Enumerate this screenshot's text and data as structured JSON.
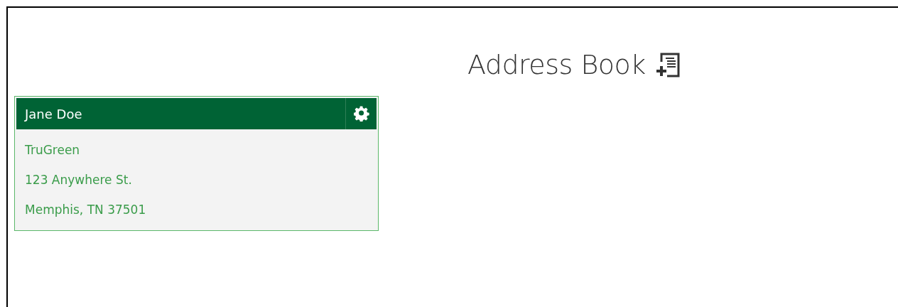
{
  "header": {
    "title": "Address Book"
  },
  "contacts": [
    {
      "name": "Jane Doe",
      "lines": [
        "TruGreen",
        "123 Anywhere St.",
        "Memphis, TN 37501"
      ]
    }
  ]
}
